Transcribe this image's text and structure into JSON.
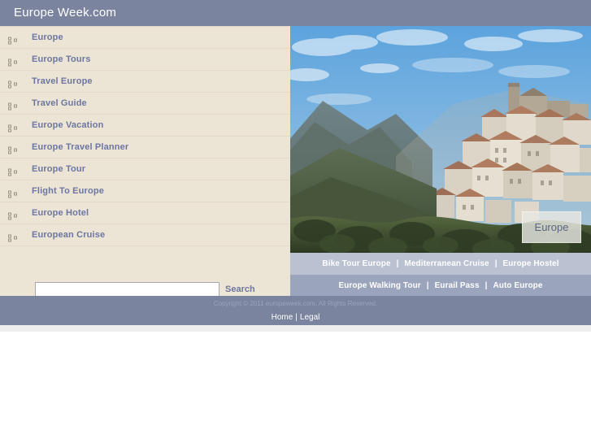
{
  "header": {
    "title": "Europe Week.com",
    "bg_color": "#7a849e"
  },
  "sidebar": {
    "bullet_icon": "list-bullet-icon",
    "bg_color": "#ece5d5",
    "items": [
      {
        "label": "Europe"
      },
      {
        "label": "Europe Tours"
      },
      {
        "label": "Travel Europe"
      },
      {
        "label": "Travel Guide"
      },
      {
        "label": "Europe Vacation"
      },
      {
        "label": "Europe Travel Planner"
      },
      {
        "label": "Europe Tour"
      },
      {
        "label": "Flight To Europe"
      },
      {
        "label": "Europe Hotel"
      },
      {
        "label": "European Cruise"
      }
    ]
  },
  "search": {
    "value": "",
    "placeholder": "",
    "button_label": "Search"
  },
  "photo": {
    "badge_label": "Europe",
    "alt_name": "hillside-village-photo"
  },
  "link_rows": [
    {
      "bg_color": "#bac2d2",
      "links": [
        "Bike Tour Europe",
        "Mediterranean Cruise",
        "Europe Hostel"
      ],
      "separator": "|"
    },
    {
      "bg_color": "#9ba4bd",
      "links": [
        "Europe Walking Tour",
        "Eurail Pass",
        "Auto Europe"
      ],
      "separator": "|"
    }
  ],
  "footer": {
    "copyright": "Copyright © 2011 europeweek.com. All Rights Reserved.",
    "links": [
      "Home",
      "Legal"
    ],
    "separator": "|",
    "bg_color": "#7a849e"
  },
  "colors": {
    "accent_blue": "#6d76a0",
    "panel_beige": "#ece5d5",
    "slate": "#7a849e"
  }
}
